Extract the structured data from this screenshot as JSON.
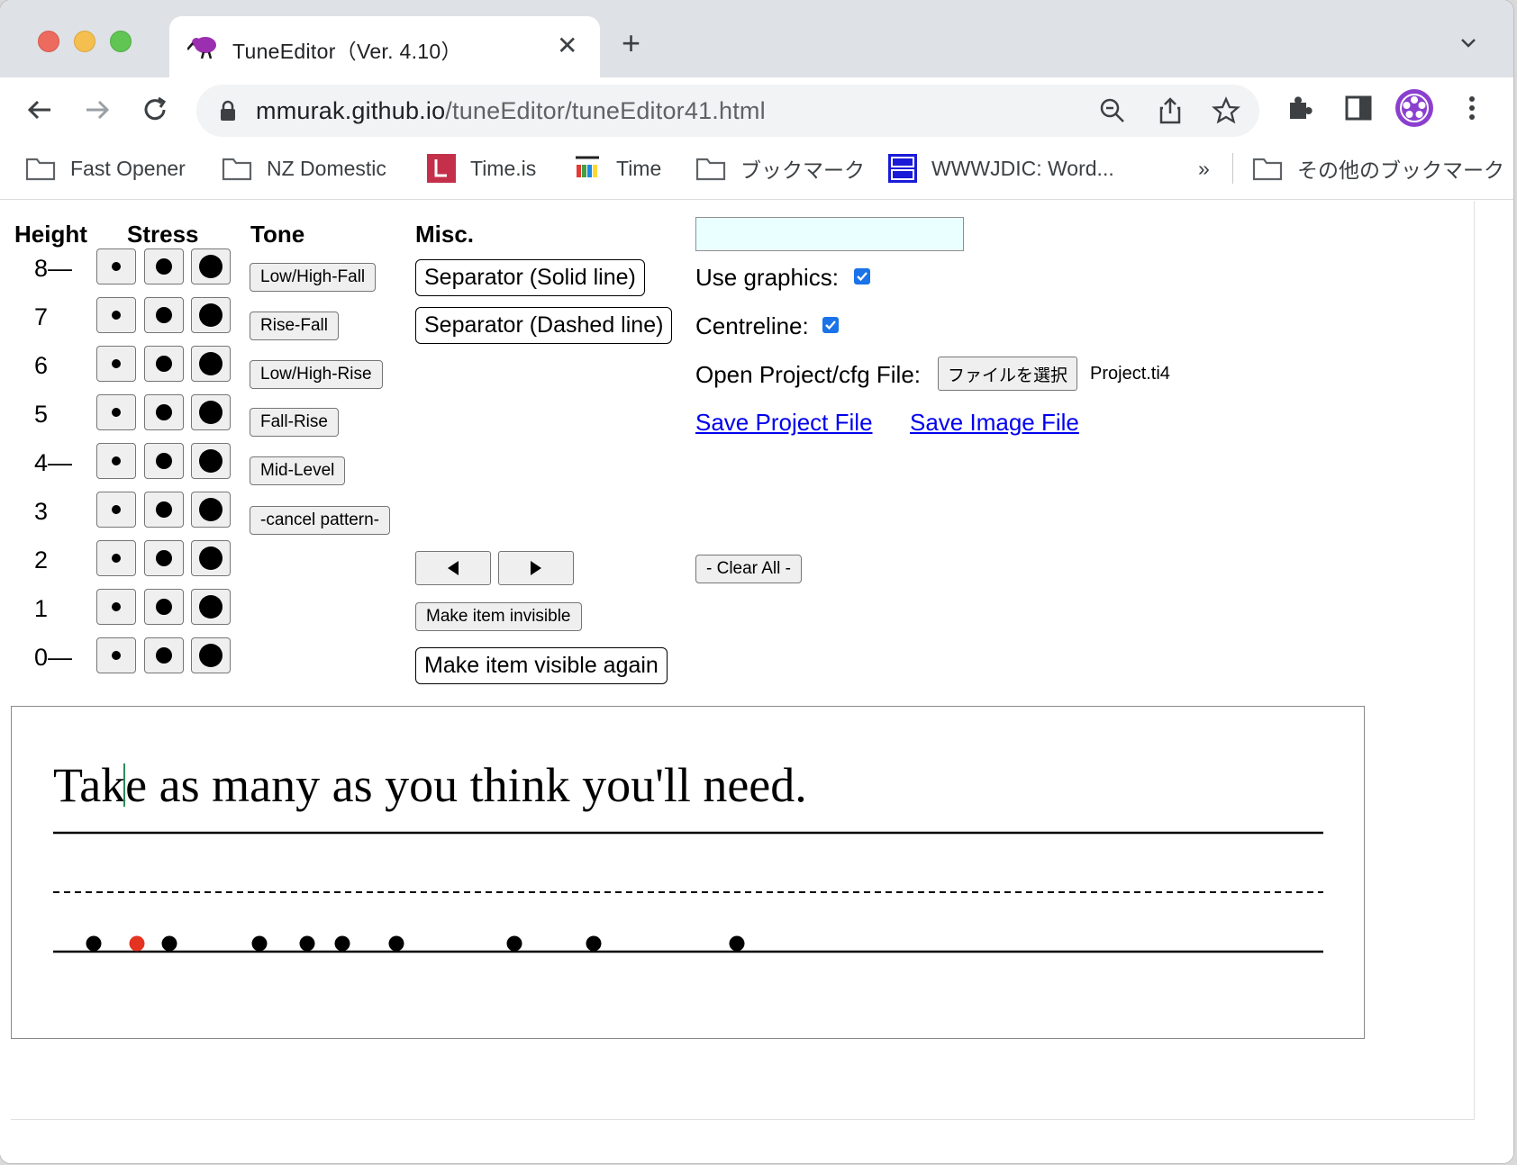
{
  "browser": {
    "tab": {
      "title": "TuneEditor（Ver. 4.10）"
    },
    "url": {
      "host": "mmurak.github.io",
      "path": "/tuneEditor/tuneEditor41.html"
    },
    "bookmarks": [
      {
        "label": "Fast Opener",
        "icon": "folder-icon"
      },
      {
        "label": "NZ Domestic",
        "icon": "folder-icon"
      },
      {
        "label": "Time.is",
        "icon": "timeis-favicon"
      },
      {
        "label": "Time",
        "icon": "time-favicon"
      },
      {
        "label": "ブックマーク",
        "icon": "folder-icon"
      },
      {
        "label": "WWWJDIC: Word...",
        "icon": "wwwjdic-favicon"
      }
    ],
    "bookmarks_overflow": "»",
    "other_bookmarks": "その他のブックマーク"
  },
  "headers": {
    "height": "Height",
    "stress": "Stress",
    "tone": "Tone",
    "misc": "Misc."
  },
  "height_rows": [
    "8—",
    "7",
    "6",
    "5",
    "4—",
    "3",
    "2",
    "1",
    "0—"
  ],
  "tone_buttons": [
    "Low/High-Fall",
    "Rise-Fall",
    "Low/High-Rise",
    "Fall-Rise",
    "Mid-Level",
    "-cancel pattern-"
  ],
  "misc": {
    "separator_solid": "Separator (Solid line)",
    "separator_dashed": "Separator (Dashed line)",
    "make_invisible": "Make item invisible",
    "make_visible": "Make item visible again",
    "use_graphics_label": "Use graphics:",
    "use_graphics_checked": true,
    "centreline_label": "Centreline:",
    "centreline_checked": true,
    "open_file_label": "Open Project/cfg File:",
    "file_button": "ファイルを選択",
    "file_name": "Project.ti4",
    "save_project": "Save Project File",
    "save_image": "Save Image File",
    "clear_all": "- Clear All -",
    "text_input_value": ""
  },
  "canvas": {
    "sentence": "Take as many as you think you'll need.",
    "dots": [
      {
        "color": "#000000"
      },
      {
        "color": "#e53322"
      },
      {
        "color": "#000000"
      },
      {
        "color": "#000000"
      },
      {
        "color": "#000000"
      },
      {
        "color": "#000000"
      },
      {
        "color": "#000000"
      },
      {
        "color": "#000000"
      },
      {
        "color": "#000000"
      },
      {
        "color": "#000000"
      }
    ]
  },
  "colors": {
    "link": "#0000ee",
    "accent": "#1a73e8",
    "selected_dot": "#e53322",
    "input_bg": "#eaffff"
  }
}
